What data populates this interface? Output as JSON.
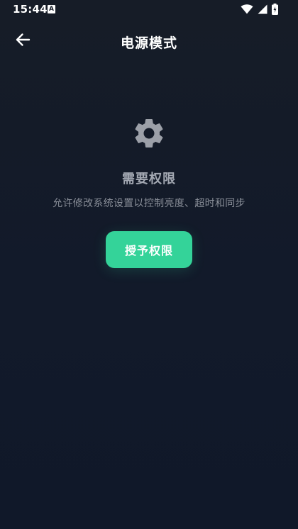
{
  "status_bar": {
    "time": "15:44",
    "notification_icon": "a-letter-icon",
    "wifi_icon": "wifi-icon",
    "signal_icon": "cell-signal-icon",
    "battery_icon": "battery-charging-icon"
  },
  "app_bar": {
    "back_icon": "arrow-left-icon",
    "title": "电源模式"
  },
  "permission": {
    "icon": "gear-icon",
    "title": "需要权限",
    "description": "允许修改系统设置以控制亮度、超时和同步",
    "button_label": "授予权限"
  },
  "colors": {
    "background": "#151b27",
    "accent": "#34d399",
    "muted_text": "#8a8f99",
    "heading_text": "#a3a8b2",
    "icon_gray": "#9ca0a8"
  }
}
